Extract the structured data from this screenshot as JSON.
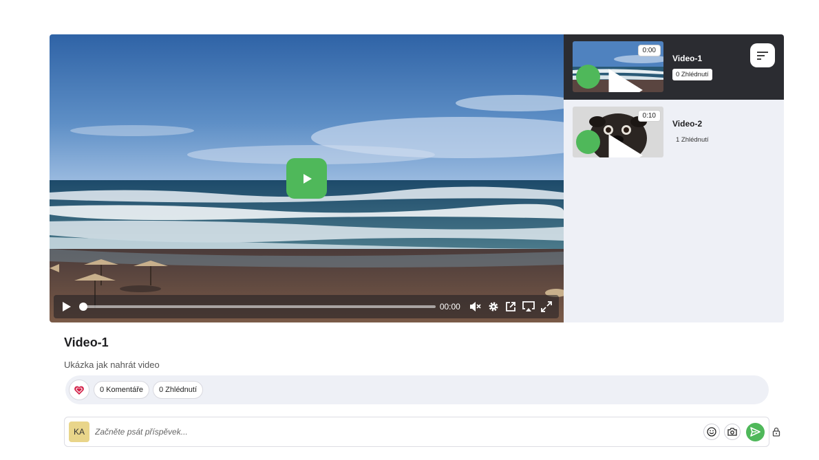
{
  "main_video": {
    "time": "00:00",
    "progress": 0,
    "icons": [
      "play-icon",
      "mute-icon",
      "settings-icon",
      "popout-icon",
      "airplay-icon",
      "fullscreen-icon"
    ]
  },
  "playlist": {
    "items": [
      {
        "title": "Video-1",
        "duration": "0:00",
        "views": "0 Zhlédnutí",
        "active": true
      },
      {
        "title": "Video-2",
        "duration": "0:10",
        "views": "1 Zhlédnutí",
        "active": false
      }
    ]
  },
  "video": {
    "title": "Video-1",
    "description": "Ukázka jak nahrát video"
  },
  "stats": {
    "comments": "0 Komentáře",
    "views": "0 Zhlédnutí"
  },
  "composer": {
    "avatar": "KA",
    "placeholder": "Začněte psát příspěvek..."
  },
  "colors": {
    "accent": "#4fb85a",
    "active_row": "#2b2c31",
    "panel": "#eef0f6",
    "heart": "#d3234a"
  }
}
